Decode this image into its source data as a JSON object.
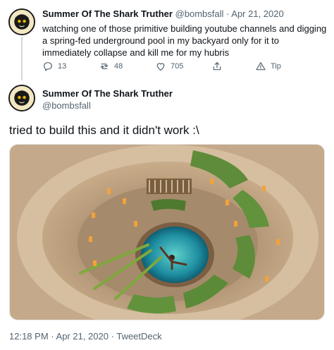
{
  "tweet1": {
    "display_name": "Summer Of The Shark Truther",
    "handle": "@bombsfall",
    "separator": "·",
    "date": "Apr 21, 2020",
    "text": "watching one of those primitive building youtube channels and digging a spring-fed underground pool in my backyard only for it to immediately collapse and kill me for my hubris",
    "actions": {
      "reply_count": "13",
      "retweet_count": "48",
      "like_count": "705",
      "tip_label": "Tip"
    }
  },
  "tweet2": {
    "display_name": "Summer Of The Shark Truther",
    "handle": "@bombsfall",
    "text": "tried to build this and it didn't work :\\",
    "footer": {
      "time": "12:18 PM",
      "date": "Apr 21, 2020",
      "client": "TweetDeck",
      "separator": "·"
    }
  },
  "colors": {
    "text": "#0f1419",
    "muted": "#536471",
    "thread_line": "#cfd9de"
  },
  "icons": [
    "reply-icon",
    "retweet-icon",
    "like-icon",
    "share-icon",
    "tip-icon"
  ]
}
